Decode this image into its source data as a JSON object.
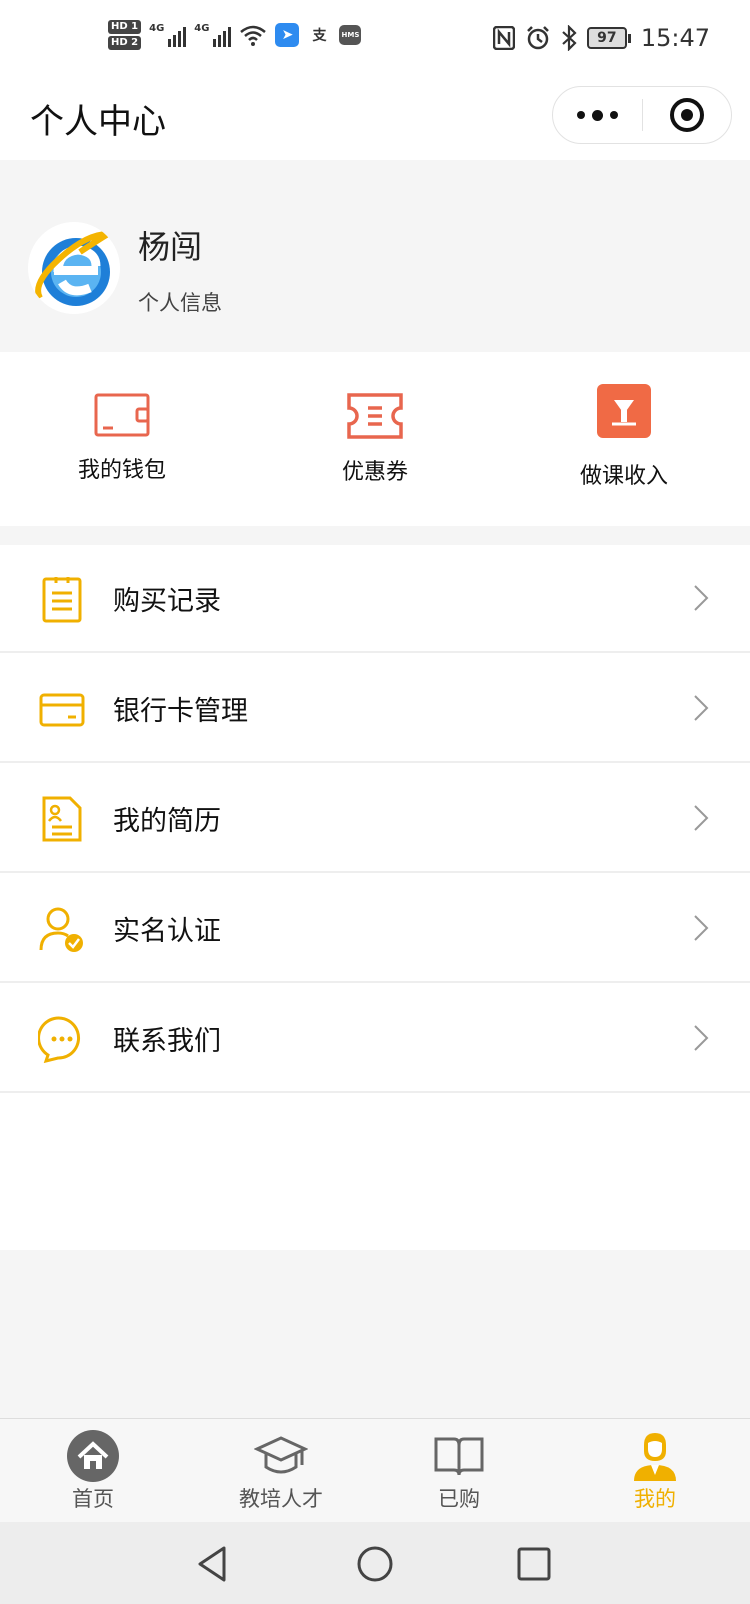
{
  "status_bar": {
    "sim1": "HD 1",
    "sim2": "HD 2",
    "network1": "4G",
    "network2": "4G",
    "alipay_glyph": "支",
    "hms_label": "HMS",
    "battery": "97",
    "time": "15:47",
    "icons": [
      "nfc-icon",
      "alarm-icon",
      "bluetooth-icon",
      "wifi-icon"
    ]
  },
  "header": {
    "title": "个人中心",
    "more_icon": "more-dots-icon",
    "close_icon": "target-close-icon"
  },
  "profile": {
    "name": "杨闯",
    "info_link": "个人信息",
    "avatar_icon": "ie-logo-avatar"
  },
  "quick_actions": [
    {
      "label": "我的钱包",
      "icon": "wallet-icon"
    },
    {
      "label": "优惠券",
      "icon": "coupon-icon"
    },
    {
      "label": "做课收入",
      "icon": "income-icon"
    }
  ],
  "menu": [
    {
      "label": "购买记录",
      "icon": "purchase-record-icon"
    },
    {
      "label": "银行卡管理",
      "icon": "bank-card-icon"
    },
    {
      "label": "我的简历",
      "icon": "resume-icon"
    },
    {
      "label": "实名认证",
      "icon": "verified-user-icon"
    },
    {
      "label": "联系我们",
      "icon": "chat-icon"
    }
  ],
  "tabs": [
    {
      "label": "首页",
      "icon": "home-icon",
      "active": false
    },
    {
      "label": "教培人才",
      "icon": "graduation-cap-icon",
      "active": false
    },
    {
      "label": "已购",
      "icon": "book-icon",
      "active": false
    },
    {
      "label": "我的",
      "icon": "user-icon",
      "active": true
    }
  ],
  "colors": {
    "accent": "#f0b000",
    "coral": "#e8664e",
    "text": "#111111",
    "background": "#f5f5f5"
  }
}
